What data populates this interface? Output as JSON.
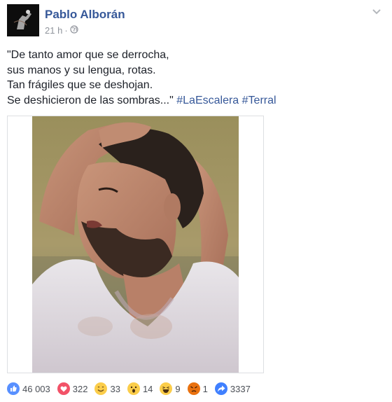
{
  "post": {
    "author": "Pablo Alborán",
    "time": "21 h",
    "separator": "·",
    "text_lines": [
      "\"De tanto amor que se derrocha,",
      "sus manos y su lengua, rotas.",
      "Tan frágiles que se deshojan.",
      "Se deshicieron de las sombras...\""
    ],
    "hashtags": [
      "#LaEscalera",
      "#Terral"
    ]
  },
  "reactions": {
    "like": "46 003",
    "love": "322",
    "haha_smile": "33",
    "wow": "14",
    "laugh": "9",
    "angry": "1",
    "share": "3337"
  },
  "colors": {
    "link": "#365899",
    "like_blue": "#5890ff",
    "love_red": "#f25268",
    "emoji_yellow": "#fbcd4a",
    "angry_red": "#e9710f",
    "share_blue": "#4080ff"
  },
  "icons": [
    "globe-icon",
    "chevron-down-icon",
    "like-icon",
    "love-icon",
    "smile-icon",
    "wow-icon",
    "haha-icon",
    "angry-icon",
    "share-icon"
  ]
}
